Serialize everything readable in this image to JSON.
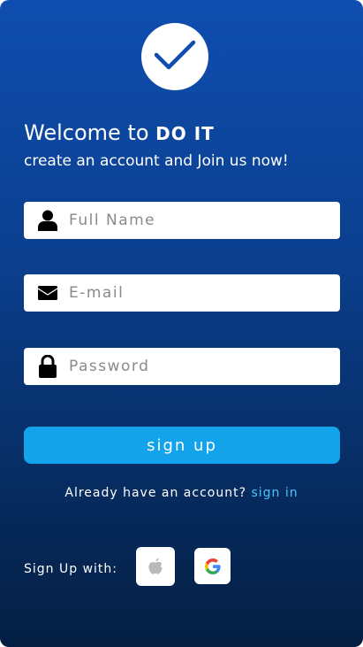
{
  "header": {
    "welcome_prefix": "Welcome to ",
    "brand": "DO IT",
    "subtitle": "create an account and Join us now!"
  },
  "form": {
    "full_name": {
      "placeholder": "Full Name",
      "value": "",
      "icon": "user-icon"
    },
    "email": {
      "placeholder": "E-mail",
      "value": "",
      "icon": "envelope-icon"
    },
    "password": {
      "placeholder": "Password",
      "value": "",
      "icon": "lock-icon"
    },
    "submit_label": "sign up"
  },
  "signin": {
    "prompt": "Already have an account?",
    "link_label": "sign in"
  },
  "social": {
    "label": "Sign Up with:",
    "providers": [
      "apple-icon",
      "google-icon"
    ]
  },
  "colors": {
    "background_top": "#0f4eb0",
    "background_bottom": "#041e42",
    "accent_button": "#12a3ea",
    "link": "#4cc3ff",
    "logo_check": "#0f4eb0"
  }
}
